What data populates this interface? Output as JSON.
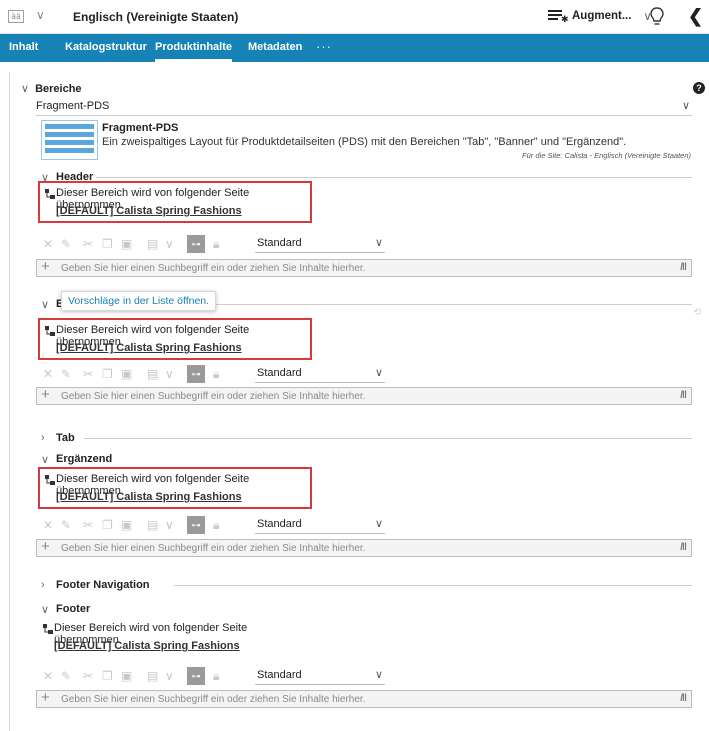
{
  "app": {
    "doc_icon": "àä",
    "title": "Englisch (Vereinigte Staaten)",
    "augment_label": "Augment..."
  },
  "tabs": [
    {
      "label": "Inhalt"
    },
    {
      "label": "Katalogstruktur"
    },
    {
      "label": "Produktinhalte"
    },
    {
      "label": "Metadaten"
    },
    {
      "label": "···"
    }
  ],
  "section": {
    "title": "Bereiche",
    "layout_select": "Fragment-PDS",
    "layout_name": "Fragment-PDS",
    "layout_desc": "Ein zweispaltiges Layout für Produktdetailseiten (PDS) mit den Bereichen \"Tab\", \"Banner\" und \"Ergänzend\".",
    "layout_site": "Für die Site: Calista - Englisch (Vereinigte Staaten)"
  },
  "tooltip": "Vorschläge in der Liste öffnen.",
  "regions": {
    "header": "Header",
    "banner": "B",
    "tab": "Tab",
    "ergaenzend": "Ergänzend",
    "footer_nav": "Footer Navigation",
    "footer": "Footer"
  },
  "inherit": {
    "text": "Dieser Bereich wird von folgender Seite übernommen",
    "link": "[DEFAULT] Calista Spring Fashions"
  },
  "toolbar": {
    "style_value": "Standard"
  },
  "search": {
    "placeholder": "Geben Sie hier einen Suchbegriff ein oder ziehen Sie Inhalte hierher."
  },
  "colors": {
    "tabbar": "#1682b5",
    "highlight_border": "#d53b3b",
    "tooltip_text": "#1682b5"
  }
}
